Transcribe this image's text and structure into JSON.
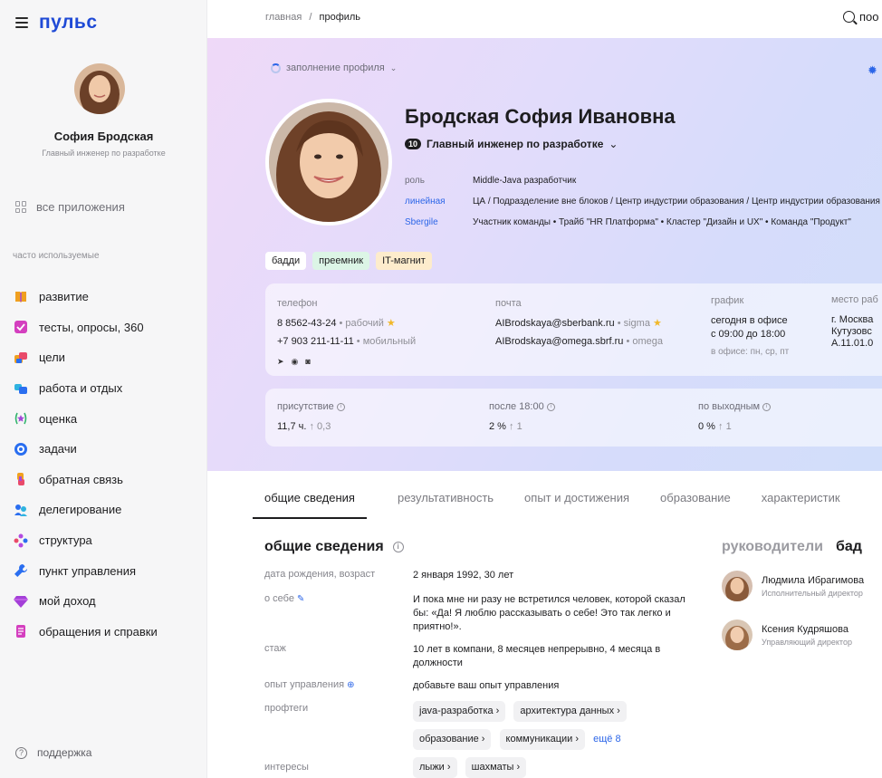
{
  "app": {
    "logo": "пульс"
  },
  "sidebar": {
    "user_name": "София Бродская",
    "user_role": "Главный инженер по разработке",
    "all_apps": "все приложения",
    "frequent_label": "часто используемые",
    "items": [
      {
        "label": "развитие",
        "icon": "book-icon",
        "color": "#f0a020"
      },
      {
        "label": "тесты, опросы, 360",
        "icon": "checkbox-icon",
        "color": "#d43fbf"
      },
      {
        "label": "цели",
        "icon": "flag-icon",
        "color": "#e94a6a"
      },
      {
        "label": "работа и отдых",
        "icon": "folders-icon",
        "color": "#2a8ff0"
      },
      {
        "label": "оценка",
        "icon": "rating-star-icon",
        "color": "#2fb36b"
      },
      {
        "label": "задачи",
        "icon": "target-icon",
        "color": "#2a6ef0"
      },
      {
        "label": "обратная связь",
        "icon": "feedback-icon",
        "color": "#f0a020"
      },
      {
        "label": "делегирование",
        "icon": "people-icon",
        "color": "#2a8ff0"
      },
      {
        "label": "структура",
        "icon": "structure-icon",
        "color": "#b34ae0"
      },
      {
        "label": "пункт управления",
        "icon": "wrench-icon",
        "color": "#2a6ef0"
      },
      {
        "label": "мой доход",
        "icon": "diamond-icon",
        "color": "#a43fd8"
      },
      {
        "label": "обращения и справки",
        "icon": "document-icon",
        "color": "#d43fbf"
      }
    ],
    "support": "поддержка"
  },
  "topbar": {
    "breadcrumb_home": "главная",
    "breadcrumb_sep": "/",
    "breadcrumb_current": "профиль",
    "search_label": "поо"
  },
  "hero": {
    "fill_profile": "заполнение профиля",
    "full_name": "Бродская София Ивановна",
    "grade": "10",
    "job_title": "Главный инженер по разработке",
    "info": [
      {
        "key": "роль",
        "value": "Middle-Java разработчик"
      },
      {
        "key": "линейная",
        "value": "ЦА  /  Подразделение вне блоков  /  Центр индустрии образования  /  Центр индустрии образования"
      },
      {
        "key": "Sbergile",
        "value": "Участник команды  •  Трайб \"HR Платформа\"  •  Кластер \"Дизайн и UX\"  •  Команда \"Продукт\""
      }
    ],
    "tags": [
      {
        "label": "бадди",
        "color": "#ffffff"
      },
      {
        "label": "преемник",
        "color": "#dcf5e6"
      },
      {
        "label": "IT-магнит",
        "color": "#fdeccc"
      }
    ],
    "contacts": {
      "phone_head": "телефон",
      "phone1": "8 8562-43-24",
      "phone1_type": "• рабочий",
      "phone2": "+7 903 211-11-11",
      "phone2_type": "• мобильный",
      "mail_head": "почта",
      "mail1": "AIBrodskaya@sberbank.ru",
      "mail1_type": "• sigma",
      "mail2": "AIBrodskaya@omega.sbrf.ru",
      "mail2_type": "• omega",
      "schedule_head": "график",
      "schedule1": "сегодня в офисе",
      "schedule2": "с 09:00 до 18:00",
      "schedule3": "в офисе: пн, ср, пт",
      "place_head": "место раб",
      "place1": "г. Москва",
      "place2": "Кутузовс",
      "place3": "А.11.01.0"
    },
    "stats": [
      {
        "label": "присутствие",
        "value": "11,7 ч.",
        "delta": "↑ 0,3"
      },
      {
        "label": "после 18:00",
        "value": "2 %",
        "delta": "↑ 1"
      },
      {
        "label": "по выходным",
        "value": "0 %",
        "delta": "↑ 1"
      }
    ]
  },
  "tabs": [
    "общие сведения",
    "результативность",
    "опыт и достижения",
    "образование",
    "характеристик"
  ],
  "general": {
    "title": "общие сведения",
    "birth_label": "дата рождения, возраст",
    "birth_value": "2 января 1992, 30 лет",
    "about_label": "о себе",
    "about_value": "И пока мне ни разу не встретился человек, которой сказал бы: «Да! Я люблю рассказывать о себе! Это так легко и приятно!».",
    "exp_label": "стаж",
    "exp_value": "10 лет в компани, 8 месяцев непрерывно, 4 месяца в должности",
    "mgmt_label": "опыт управления",
    "mgmt_value": "добавьте ваш опыт управления",
    "tags_label": "профтеги",
    "tags": [
      "java-разработка",
      "архитектура данных",
      "образование",
      "коммуникации"
    ],
    "tags_more": "ещё 8",
    "interests_label": "интересы",
    "interests": [
      "лыжи",
      "шахматы"
    ]
  },
  "managers": {
    "title": "руководители",
    "title2": "бад",
    "list": [
      {
        "name": "Людмила Ибрагимова",
        "role": "Исполнительный директор"
      },
      {
        "name": "Ксения Кудряшова",
        "role": "Управляющий директор"
      }
    ]
  }
}
